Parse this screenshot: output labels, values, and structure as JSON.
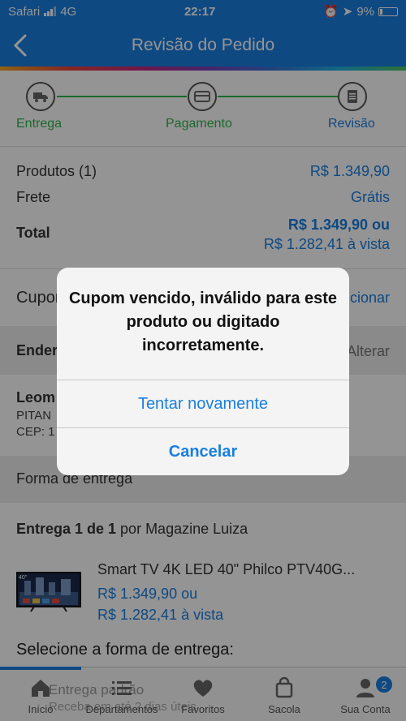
{
  "status_bar": {
    "carrier": "Safari",
    "network": "4G",
    "time": "22:17",
    "battery": "9%"
  },
  "header": {
    "title": "Revisão do Pedido"
  },
  "stepper": {
    "steps": [
      {
        "label": "Entrega"
      },
      {
        "label": "Pagamento"
      },
      {
        "label": "Revisão"
      }
    ]
  },
  "summary": {
    "products_label": "Produtos (1)",
    "products_value": "R$ 1.349,90",
    "shipping_label": "Frete",
    "shipping_value": "Grátis",
    "total_label": "Total",
    "total_value": "R$ 1.349,90 ou",
    "total_cash": "R$ 1.282,41 à vista"
  },
  "coupon": {
    "label": "Cupom",
    "action": "Adicionar"
  },
  "address": {
    "title": "Endereço de entrega",
    "action": "Alterar",
    "name": "Leom",
    "line1": "PITAN",
    "line2": "CEP: 1"
  },
  "delivery": {
    "title": "Forma de entrega",
    "shipment_bold": "Entrega 1 de 1",
    "shipment_rest": " por Magazine Luiza",
    "product_name": "Smart TV 4K LED 40\" Philco PTV40G...",
    "product_price": "R$ 1.349,90 ou",
    "product_cash": "R$ 1.282,41 à vista",
    "tv_badge": "40\"",
    "select_title": "Selecione a forma de entrega:",
    "option_1": "Entrega padrão",
    "option_2": "Receba em até 2 dias úteis"
  },
  "dialog": {
    "message": "Cupom vencido, inválido para este produto ou digitado incorretamente.",
    "retry": "Tentar novamente",
    "cancel": "Cancelar"
  },
  "tabs": [
    {
      "label": "Início",
      "icon": "home-icon"
    },
    {
      "label": "Departamentos",
      "icon": "list-icon"
    },
    {
      "label": "Favoritos",
      "icon": "heart-icon"
    },
    {
      "label": "Sacola",
      "icon": "bag-icon"
    },
    {
      "label": "Sua Conta",
      "icon": "user-icon",
      "badge": "2"
    }
  ],
  "colors": {
    "primary": "#1a7fe0",
    "success": "#2db34a",
    "overlay": "rgba(0,0,0,0.42)"
  }
}
